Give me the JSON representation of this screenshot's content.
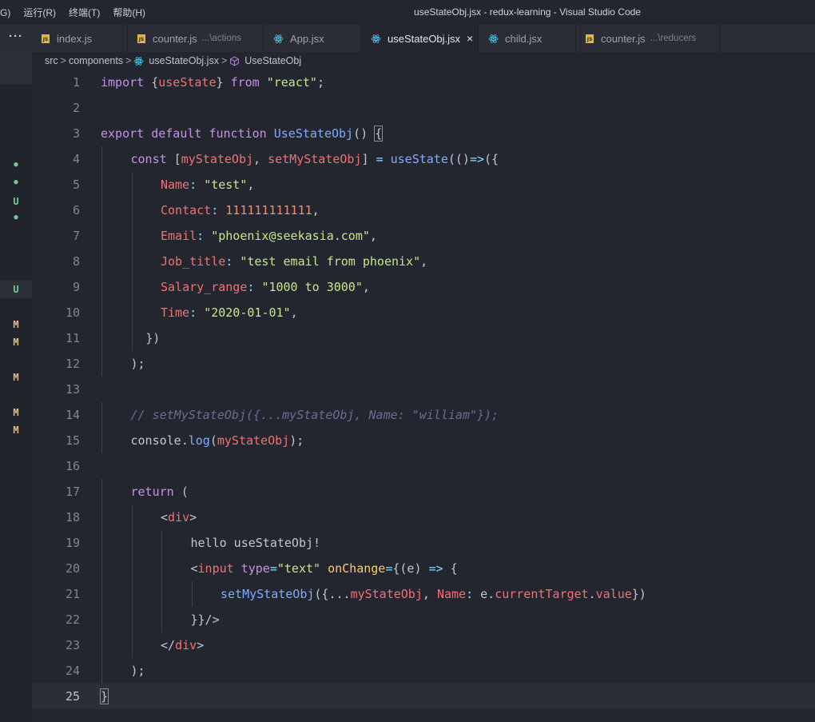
{
  "menu": {
    "items": [
      "G)",
      "运行(R)",
      "终端(T)",
      "帮助(H)"
    ]
  },
  "window_title": "useStateObj.jsx - redux-learning - Visual Studio Code",
  "tabbar": {
    "more": "···",
    "tabs": [
      {
        "label": "index.js",
        "icon": "js-file-icon",
        "desc": ""
      },
      {
        "label": "counter.js",
        "icon": "js-file-icon",
        "desc": "...\\actions"
      },
      {
        "label": "App.jsx",
        "icon": "react-icon",
        "desc": ""
      },
      {
        "label": "useStateObj.jsx",
        "icon": "react-icon",
        "desc": "",
        "active": true,
        "close": "×"
      },
      {
        "label": "child.jsx",
        "icon": "react-icon",
        "desc": ""
      },
      {
        "label": "counter.js",
        "icon": "js-file-icon",
        "desc": "...\\reducers"
      }
    ]
  },
  "breadcrumb": {
    "items": [
      "src",
      "components",
      "useStateObj.jsx",
      "UseStateObj"
    ],
    "sep": ">"
  },
  "gutter_markers": [
    "●",
    "●",
    "U",
    "●",
    "U",
    "M",
    "M",
    "M",
    "M",
    "M"
  ],
  "editor": {
    "current_line": 25,
    "lines": [
      {
        "n": 1,
        "indent": 0,
        "tokens": [
          [
            "kw",
            "import"
          ],
          [
            "pl",
            " {"
          ],
          [
            "var",
            "useState"
          ],
          [
            "pl",
            "} "
          ],
          [
            "kw",
            "from"
          ],
          [
            "pl",
            " "
          ],
          [
            "str",
            "\"react\""
          ],
          [
            "pl",
            ";"
          ]
        ]
      },
      {
        "n": 2,
        "indent": 0,
        "tokens": []
      },
      {
        "n": 3,
        "indent": 0,
        "tokens": [
          [
            "kw",
            "export"
          ],
          [
            "pl",
            " "
          ],
          [
            "kw",
            "default"
          ],
          [
            "pl",
            " "
          ],
          [
            "kw",
            "function"
          ],
          [
            "pl",
            " "
          ],
          [
            "fn",
            "UseStateObj"
          ],
          [
            "pl",
            "() "
          ],
          [
            "pl",
            "{"
          ]
        ]
      },
      {
        "n": 4,
        "indent": 1,
        "tokens": [
          [
            "kw",
            "const"
          ],
          [
            "pl",
            " ["
          ],
          [
            "var",
            "myStateObj"
          ],
          [
            "pl",
            ", "
          ],
          [
            "var",
            "setMyStateObj"
          ],
          [
            "pl",
            "] "
          ],
          [
            "op",
            "="
          ],
          [
            "pl",
            " "
          ],
          [
            "fn",
            "useState"
          ],
          [
            "pl",
            "(()"
          ],
          [
            "op",
            "=>"
          ],
          [
            "pl",
            "({"
          ]
        ]
      },
      {
        "n": 5,
        "indent": 2,
        "tokens": [
          [
            "prop",
            "Name"
          ],
          [
            "op",
            ":"
          ],
          [
            "pl",
            " "
          ],
          [
            "str",
            "\"test\""
          ],
          [
            "pl",
            ","
          ]
        ]
      },
      {
        "n": 6,
        "indent": 2,
        "tokens": [
          [
            "prop",
            "Contact"
          ],
          [
            "op",
            ":"
          ],
          [
            "pl",
            " "
          ],
          [
            "num",
            "111111111111"
          ],
          [
            "pl",
            ","
          ]
        ]
      },
      {
        "n": 7,
        "indent": 2,
        "tokens": [
          [
            "prop",
            "Email"
          ],
          [
            "op",
            ":"
          ],
          [
            "pl",
            " "
          ],
          [
            "str",
            "\"phoenix@seekasia.com\""
          ],
          [
            "pl",
            ","
          ]
        ]
      },
      {
        "n": 8,
        "indent": 2,
        "tokens": [
          [
            "prop",
            "Job_title"
          ],
          [
            "op",
            ":"
          ],
          [
            "pl",
            " "
          ],
          [
            "str",
            "\"test email from phoenix\""
          ],
          [
            "pl",
            ","
          ]
        ]
      },
      {
        "n": 9,
        "indent": 2,
        "tokens": [
          [
            "prop",
            "Salary_range"
          ],
          [
            "op",
            ":"
          ],
          [
            "pl",
            " "
          ],
          [
            "str",
            "\"1000 to 3000\""
          ],
          [
            "pl",
            ","
          ]
        ]
      },
      {
        "n": 10,
        "indent": 2,
        "tokens": [
          [
            "prop",
            "Time"
          ],
          [
            "op",
            ":"
          ],
          [
            "pl",
            " "
          ],
          [
            "str",
            "\"2020-01-01\""
          ],
          [
            "pl",
            ","
          ]
        ]
      },
      {
        "n": 11,
        "indent": 1.5,
        "tokens": [
          [
            "pl",
            "})"
          ]
        ]
      },
      {
        "n": 12,
        "indent": 1,
        "tokens": [
          [
            "pl",
            ");"
          ]
        ]
      },
      {
        "n": 13,
        "indent": 0,
        "tokens": []
      },
      {
        "n": 14,
        "indent": 1,
        "tokens": [
          [
            "cm",
            "// setMyStateObj({...myStateObj, Name: \"william\"});"
          ]
        ]
      },
      {
        "n": 15,
        "indent": 1,
        "tokens": [
          [
            "pl",
            "console."
          ],
          [
            "fn",
            "log"
          ],
          [
            "pl",
            "("
          ],
          [
            "var",
            "myStateObj"
          ],
          [
            "pl",
            ");"
          ]
        ]
      },
      {
        "n": 16,
        "indent": 0,
        "tokens": []
      },
      {
        "n": 17,
        "indent": 1,
        "tokens": [
          [
            "kw",
            "return"
          ],
          [
            "pl",
            " ("
          ]
        ]
      },
      {
        "n": 18,
        "indent": 2,
        "tokens": [
          [
            "pl",
            "<"
          ],
          [
            "tag",
            "div"
          ],
          [
            "pl",
            ">"
          ]
        ]
      },
      {
        "n": 19,
        "indent": 3,
        "tokens": [
          [
            "pl",
            "hello useStateObj!"
          ]
        ]
      },
      {
        "n": 20,
        "indent": 3,
        "tokens": [
          [
            "pl",
            "<"
          ],
          [
            "tag",
            "input"
          ],
          [
            "pl",
            " "
          ],
          [
            "kw",
            "type"
          ],
          [
            "op",
            "="
          ],
          [
            "str",
            "\"text\""
          ],
          [
            "pl",
            " "
          ],
          [
            "attr",
            "onChange"
          ],
          [
            "op",
            "="
          ],
          [
            "pl",
            "{(e) "
          ],
          [
            "op",
            "=>"
          ],
          [
            "pl",
            " {"
          ]
        ]
      },
      {
        "n": 21,
        "indent": 4,
        "tokens": [
          [
            "fn",
            "setMyStateObj"
          ],
          [
            "pl",
            "({..."
          ],
          [
            "var",
            "myStateObj"
          ],
          [
            "pl",
            ", "
          ],
          [
            "var",
            "Name"
          ],
          [
            "op",
            ":"
          ],
          [
            "pl",
            " e."
          ],
          [
            "var",
            "currentTarget"
          ],
          [
            "pl",
            "."
          ],
          [
            "var",
            "value"
          ],
          [
            "pl",
            "})"
          ]
        ]
      },
      {
        "n": 22,
        "indent": 3,
        "tokens": [
          [
            "pl",
            "}}/>"
          ]
        ]
      },
      {
        "n": 23,
        "indent": 2,
        "tokens": [
          [
            "pl",
            "</"
          ],
          [
            "tag",
            "div"
          ],
          [
            "pl",
            ">"
          ]
        ]
      },
      {
        "n": 24,
        "indent": 1,
        "tokens": [
          [
            "pl",
            ");"
          ]
        ]
      },
      {
        "n": 25,
        "indent": 0,
        "tokens": [
          [
            "pl",
            "}"
          ]
        ]
      }
    ]
  }
}
